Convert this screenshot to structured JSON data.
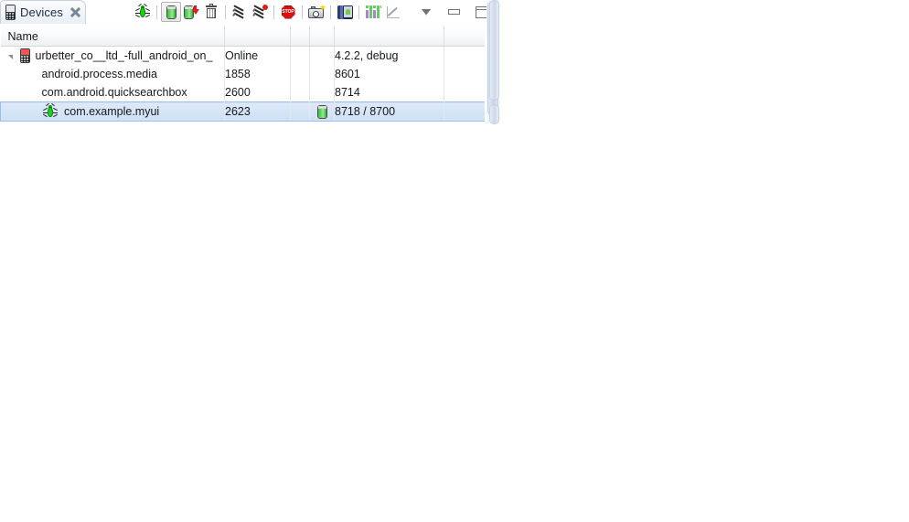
{
  "window": {
    "title": "Devices"
  },
  "tab": {
    "label": "Devices",
    "icon": "phone-icon",
    "close_icon": "close-icon"
  },
  "toolbar": {
    "items": [
      {
        "name": "debug-process-icon",
        "label": "Debug the selected process",
        "icon": "green-bug-icon",
        "pressed": false
      },
      {
        "name": "update-heap-icon",
        "label": "Update Heap",
        "icon": "heap-capsule-icon",
        "pressed": true
      },
      {
        "name": "dump-hprof-icon",
        "label": "Dump HPROF file",
        "icon": "heap-capsule-download-icon",
        "pressed": false
      },
      {
        "name": "cause-gc-icon",
        "label": "Cause GC",
        "icon": "trash-icon",
        "pressed": false
      },
      {
        "name": "update-threads-icon",
        "label": "Update Threads",
        "icon": "threads-icon",
        "pressed": false
      },
      {
        "name": "start-method-profiling-icon",
        "label": "Start Method Profiling",
        "icon": "threads-record-icon",
        "pressed": false
      },
      {
        "name": "stop-process-icon",
        "label": "Stop Process",
        "icon": "stop-icon",
        "pressed": false
      },
      {
        "name": "screen-capture-icon",
        "label": "Screen Capture",
        "icon": "camera-icon",
        "pressed": false
      },
      {
        "name": "dump-view-hierarchy-icon",
        "label": "Dump View Hierarchy for UI Automator",
        "icon": "device-android-icon",
        "pressed": false
      },
      {
        "name": "capture-system-wide-trace-icon",
        "label": "Capture system wide trace using Android systrace",
        "icon": "bar-chart-icon",
        "pressed": false
      },
      {
        "name": "opengl-trace-icon",
        "label": "OpenGL Trace",
        "icon": "line-chart-icon",
        "pressed": false
      },
      {
        "name": "view-menu-icon",
        "label": "View Menu",
        "icon": "triangle-down-icon",
        "pressed": false
      },
      {
        "name": "minimize-icon",
        "label": "Minimize",
        "icon": "minimize-icon",
        "pressed": false
      },
      {
        "name": "maximize-icon",
        "label": "Maximize",
        "icon": "maximize-icon",
        "pressed": false
      }
    ]
  },
  "table": {
    "columns": [
      {
        "key": "name",
        "label": "Name"
      },
      {
        "key": "state",
        "label": ""
      },
      {
        "key": "c3",
        "label": ""
      },
      {
        "key": "c4",
        "label": ""
      },
      {
        "key": "info",
        "label": ""
      },
      {
        "key": "last",
        "label": ""
      }
    ],
    "rows": [
      {
        "type": "device",
        "expanded": true,
        "icon": "phone-device-icon",
        "name": "urbetter_co__ltd_-full_android_on_",
        "state": "Online",
        "c3": "",
        "c4": "",
        "info": "4.2.2, debug",
        "last": "",
        "selected": false
      },
      {
        "type": "process",
        "icon": "",
        "name": "android.process.media",
        "state": "1858",
        "c3": "",
        "c4": "",
        "info": "8601",
        "last": "",
        "selected": false
      },
      {
        "type": "process",
        "icon": "",
        "name": "com.android.quicksearchbox",
        "state": "2600",
        "c3": "",
        "c4": "",
        "info": "8714",
        "last": "",
        "selected": false
      },
      {
        "type": "process",
        "icon": "green-bug-icon",
        "name": "com.example.myui",
        "state": "2623",
        "c3": "",
        "c4": "heap-capsule-icon",
        "info": "8718 / 8700",
        "last": "",
        "selected": true
      }
    ]
  },
  "scrollbar": {
    "name": "vertical-scrollbar",
    "orientation": "vertical"
  },
  "colors": {
    "selection_fill": "#dce9f9",
    "selection_border": "#9cc0e8",
    "header_bg": "#f7f8fa",
    "bug_green": "#14d814",
    "stop_red": "#d61212",
    "page_bg": "#ffffff"
  }
}
